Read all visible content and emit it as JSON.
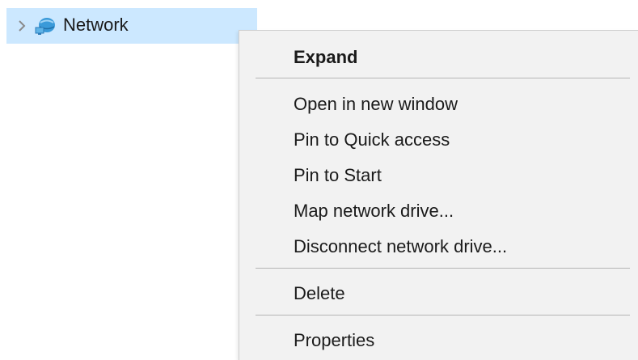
{
  "tree": {
    "item_label": "Network"
  },
  "context_menu": {
    "expand": "Expand",
    "open_new_window": "Open in new window",
    "pin_quick_access": "Pin to Quick access",
    "pin_start": "Pin to Start",
    "map_drive": "Map network drive...",
    "disconnect_drive": "Disconnect network drive...",
    "delete": "Delete",
    "properties": "Properties"
  },
  "icons": {
    "chevron": "chevron-right-icon",
    "network": "network-icon"
  },
  "colors": {
    "selection_bg": "#cce8ff",
    "menu_bg": "#f2f2f2",
    "separator": "#b5b5b5"
  }
}
